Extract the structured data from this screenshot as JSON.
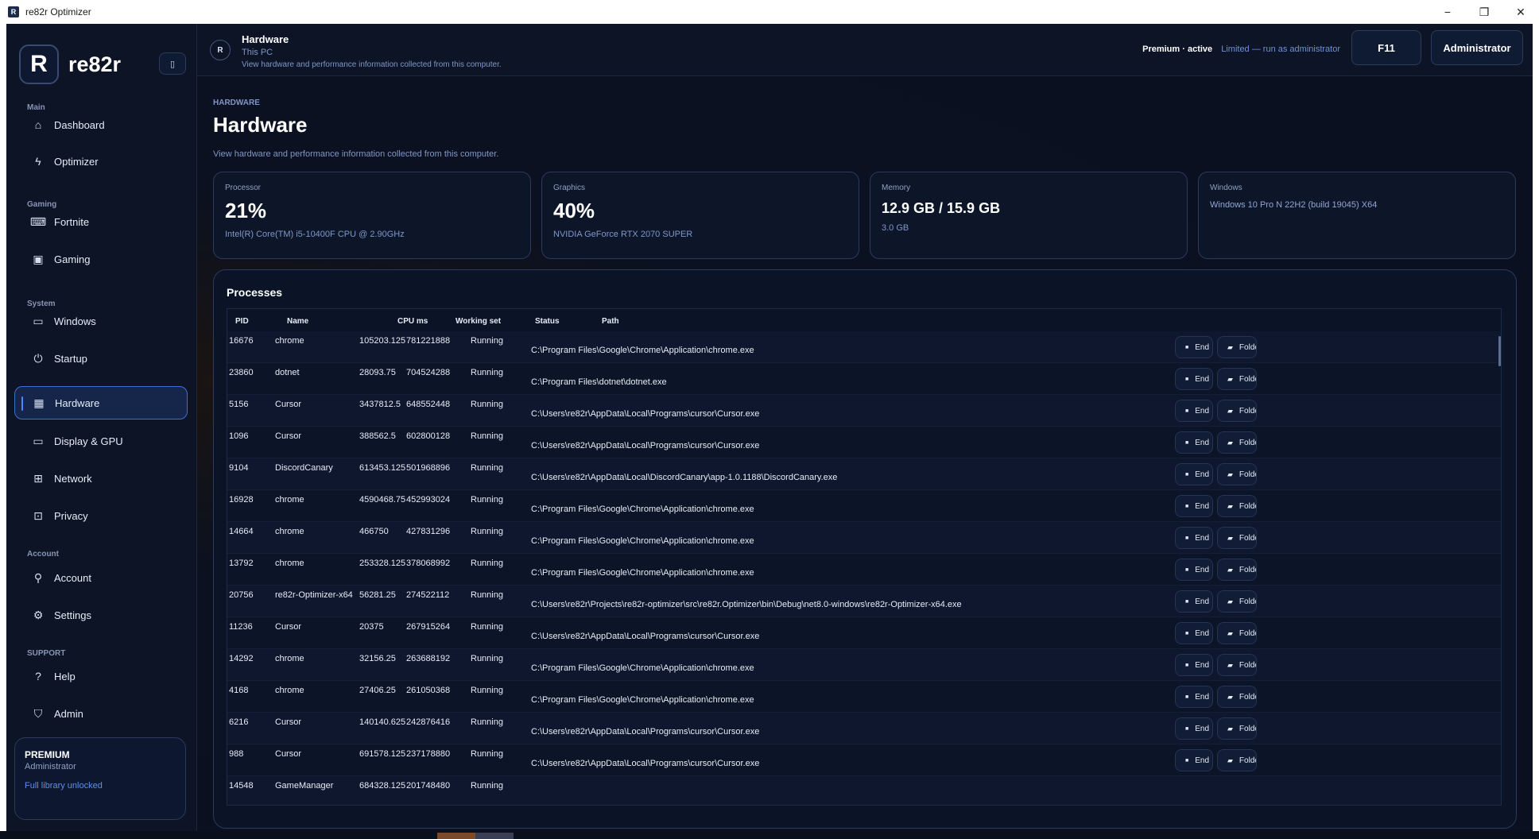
{
  "window": {
    "title": "re82r Optimizer",
    "icon_letter": "R"
  },
  "window_controls": {
    "minimize": "−",
    "restore": "❐",
    "close": "✕"
  },
  "brand": {
    "logo": "R",
    "name": "re82r",
    "collapse_icon": "▯"
  },
  "sidebar": {
    "sections": [
      {
        "label": "Main"
      },
      {
        "label": "Gaming"
      },
      {
        "label": "System"
      },
      {
        "label": "Account"
      },
      {
        "label": "SUPPORT"
      }
    ],
    "items": [
      {
        "label": "Dashboard",
        "icon": "⌂",
        "icon_name": "home-icon"
      },
      {
        "label": "Optimizer",
        "icon": "ϟ",
        "icon_name": "bolt-icon"
      },
      {
        "label": "Fortnite",
        "icon": "⌨",
        "icon_name": "gamepad-icon"
      },
      {
        "label": "Gaming",
        "icon": "▣",
        "icon_name": "image-icon"
      },
      {
        "label": "Windows",
        "icon": "▭",
        "icon_name": "laptop-icon"
      },
      {
        "label": "Startup",
        "icon": "⏻",
        "icon_name": "power-icon"
      },
      {
        "label": "Hardware",
        "icon": "▦",
        "icon_name": "chip-icon"
      },
      {
        "label": "Display & GPU",
        "icon": "▭",
        "icon_name": "monitor-icon"
      },
      {
        "label": "Network",
        "icon": "⊞",
        "icon_name": "network-icon"
      },
      {
        "label": "Privacy",
        "icon": "⊡",
        "icon_name": "lock-icon"
      },
      {
        "label": "Account",
        "icon": "⚲",
        "icon_name": "user-icon"
      },
      {
        "label": "Settings",
        "icon": "⚙",
        "icon_name": "gear-icon"
      },
      {
        "label": "Help",
        "icon": "?",
        "icon_name": "help-icon"
      },
      {
        "label": "Admin",
        "icon": "⛉",
        "icon_name": "shield-icon"
      }
    ],
    "active": "Hardware"
  },
  "premium_card": {
    "title": "PREMIUM",
    "role": "Administrator",
    "note": "Full library unlocked"
  },
  "header": {
    "avatar": "R",
    "title": "Hardware",
    "subtitle": "This PC",
    "description": "View hardware and performance information collected from this computer.",
    "status_strong": "Premium · active",
    "status_limited": "Limited — run as administrator",
    "f11_label": "F11",
    "admin_label": "Administrator"
  },
  "page": {
    "eyebrow": "HARDWARE",
    "title": "Hardware",
    "description": "View hardware and performance information collected from this computer."
  },
  "stats": {
    "processor": {
      "label": "Processor",
      "value": "21%",
      "detail": "Intel(R) Core(TM) i5-10400F CPU @ 2.90GHz"
    },
    "graphics": {
      "label": "Graphics",
      "value": "40%",
      "detail": "NVIDIA GeForce RTX 2070 SUPER"
    },
    "memory": {
      "label": "Memory",
      "value": "12.9 GB / 15.9 GB",
      "detail": "3.0 GB"
    },
    "windows": {
      "label": "Windows",
      "detail": "Windows 10 Pro N 22H2 (build 19045) X64"
    }
  },
  "processes": {
    "title": "Processes",
    "columns": {
      "pid": "PID",
      "name": "Name",
      "cpu": "CPU ms",
      "ws": "Working set",
      "status": "Status",
      "path": "Path"
    },
    "end_label": "End",
    "folder_label": "Folder",
    "rows": [
      {
        "pid": "16676",
        "name": "chrome",
        "cpu": "105203.125",
        "ws": "781221888",
        "status": "Running",
        "path": "C:\\Program Files\\Google\\Chrome\\Application\\chrome.exe"
      },
      {
        "pid": "23860",
        "name": "dotnet",
        "cpu": "28093.75",
        "ws": "704524288",
        "status": "Running",
        "path": "C:\\Program Files\\dotnet\\dotnet.exe"
      },
      {
        "pid": "5156",
        "name": "Cursor",
        "cpu": "3437812.5",
        "ws": "648552448",
        "status": "Running",
        "path": "C:\\Users\\re82r\\AppData\\Local\\Programs\\cursor\\Cursor.exe"
      },
      {
        "pid": "1096",
        "name": "Cursor",
        "cpu": "388562.5",
        "ws": "602800128",
        "status": "Running",
        "path": "C:\\Users\\re82r\\AppData\\Local\\Programs\\cursor\\Cursor.exe"
      },
      {
        "pid": "9104",
        "name": "DiscordCanary",
        "cpu": "613453.125",
        "ws": "501968896",
        "status": "Running",
        "path": "C:\\Users\\re82r\\AppData\\Local\\DiscordCanary\\app-1.0.1188\\DiscordCanary.exe"
      },
      {
        "pid": "16928",
        "name": "chrome",
        "cpu": "4590468.75",
        "ws": "452993024",
        "status": "Running",
        "path": "C:\\Program Files\\Google\\Chrome\\Application\\chrome.exe"
      },
      {
        "pid": "14664",
        "name": "chrome",
        "cpu": "466750",
        "ws": "427831296",
        "status": "Running",
        "path": "C:\\Program Files\\Google\\Chrome\\Application\\chrome.exe"
      },
      {
        "pid": "13792",
        "name": "chrome",
        "cpu": "253328.125",
        "ws": "378068992",
        "status": "Running",
        "path": "C:\\Program Files\\Google\\Chrome\\Application\\chrome.exe"
      },
      {
        "pid": "20756",
        "name": "re82r-Optimizer-x64",
        "cpu": "56281.25",
        "ws": "274522112",
        "status": "Running",
        "path": "C:\\Users\\re82r\\Projects\\re82r-optimizer\\src\\re82r.Optimizer\\bin\\Debug\\net8.0-windows\\re82r-Optimizer-x64.exe"
      },
      {
        "pid": "11236",
        "name": "Cursor",
        "cpu": "20375",
        "ws": "267915264",
        "status": "Running",
        "path": "C:\\Users\\re82r\\AppData\\Local\\Programs\\cursor\\Cursor.exe"
      },
      {
        "pid": "14292",
        "name": "chrome",
        "cpu": "32156.25",
        "ws": "263688192",
        "status": "Running",
        "path": "C:\\Program Files\\Google\\Chrome\\Application\\chrome.exe"
      },
      {
        "pid": "4168",
        "name": "chrome",
        "cpu": "27406.25",
        "ws": "261050368",
        "status": "Running",
        "path": "C:\\Program Files\\Google\\Chrome\\Application\\chrome.exe"
      },
      {
        "pid": "6216",
        "name": "Cursor",
        "cpu": "140140.625",
        "ws": "242876416",
        "status": "Running",
        "path": "C:\\Users\\re82r\\AppData\\Local\\Programs\\cursor\\Cursor.exe"
      },
      {
        "pid": "988",
        "name": "Cursor",
        "cpu": "691578.125",
        "ws": "237178880",
        "status": "Running",
        "path": "C:\\Users\\re82r\\AppData\\Local\\Programs\\cursor\\Cursor.exe"
      },
      {
        "pid": "14548",
        "name": "GameManager",
        "cpu": "684328.125",
        "ws": "201748480",
        "status": "Running",
        "path": ""
      }
    ]
  }
}
